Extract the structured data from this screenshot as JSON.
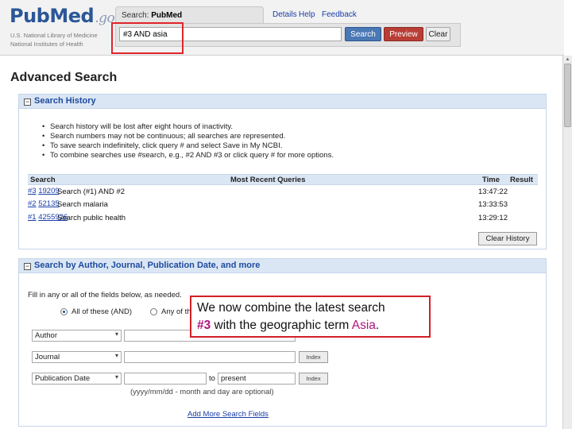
{
  "header": {
    "logo_main": "PubMed",
    "logo_suffix": ".gov",
    "nlm_line1": "U.S. National Library of Medicine",
    "nlm_line2": "National Institutes of Health",
    "search_tab_prefix": "Search: ",
    "search_tab_db": "PubMed",
    "search_value": "#3 AND asia",
    "search_button": "Search",
    "preview_button": "Preview",
    "clear_button": "Clear",
    "links": [
      "Details",
      "Help",
      "Feedback"
    ]
  },
  "page_title": "Advanced Search",
  "history_section": {
    "title": "Search History",
    "bullets": [
      "Search history will be lost after eight hours of inactivity.",
      "Search numbers may not be continuous; all searches are represented.",
      "To save search indefinitely, click query # and select Save in My NCBI.",
      "To combine searches use #search, e.g., #2 AND #3 or click query # for more options."
    ],
    "columns": {
      "search": "Search",
      "queries": "Most Recent Queries",
      "time": "Time",
      "result": "Result"
    },
    "rows": [
      {
        "num": "#3",
        "query": "Search (#1) AND #2",
        "time": "13:47:22",
        "result": "19209"
      },
      {
        "num": "#2",
        "query": "Search malaria",
        "time": "13:33:53",
        "result": "52135"
      },
      {
        "num": "#1",
        "query": "Search public health",
        "time": "13:29:12",
        "result": "4255926"
      }
    ],
    "clear_history_button": "Clear History"
  },
  "builder_section": {
    "title": "Search by Author, Journal, Publication Date, and more",
    "instruction": "Fill in any or all of the fields below, as needed.",
    "radio_all": "All of these (AND)",
    "radio_any": "Any of these (OR)",
    "fields": [
      {
        "label": "Author",
        "value": ""
      },
      {
        "label": "Journal",
        "value": ""
      },
      {
        "label": "Publication Date",
        "value": ""
      }
    ],
    "index_button": "Index",
    "to_label": "to",
    "to_value": "present",
    "date_hint": "(yyyy/mm/dd - month and day are optional)",
    "add_more": "Add More Search Fields"
  },
  "callout": {
    "line_part1": "We now combine the latest search",
    "ref": "#3",
    "line_part2": " with the geographic term ",
    "term": "Asia",
    "end": "."
  },
  "colors": {
    "highlight_red": "#e0242a",
    "link_blue": "#1a3ea8",
    "section_blue": "#dbe6f4",
    "callout_accent": "#b0127f"
  }
}
